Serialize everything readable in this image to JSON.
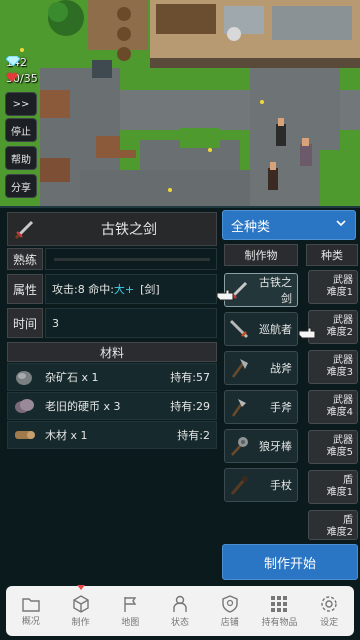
{
  "hud": {
    "diamonds": "142",
    "hp": "30/35"
  },
  "side_buttons": [
    ">>",
    "停止",
    "帮助",
    "分享"
  ],
  "item": {
    "name": "古铁之剑",
    "rows": [
      {
        "label": "熟练",
        "value": ""
      },
      {
        "label": "属性",
        "attack_text": "攻击:8 命中:",
        "hit_value": "大+",
        "tag": "[剑]"
      },
      {
        "label": "时间",
        "value": "3"
      }
    ]
  },
  "materials": {
    "title": "材料",
    "items": [
      {
        "name": "杂矿石 x 1",
        "have": "持有:57",
        "icon": "ore-icon"
      },
      {
        "name": "老旧的硬币 x 3",
        "have": "持有:29",
        "icon": "coin-icon"
      },
      {
        "name": "木材 x 1",
        "have": "持有:2",
        "icon": "wood-icon"
      }
    ]
  },
  "filter": {
    "selected": "全种类"
  },
  "craft_list": {
    "header": "制作物",
    "items": [
      {
        "name": "古铁之剑",
        "icon": "sword-icon"
      },
      {
        "name": "巡航者",
        "icon": "spear-icon"
      },
      {
        "name": "战斧",
        "icon": "axe-icon"
      },
      {
        "name": "手斧",
        "icon": "hatchet-icon"
      },
      {
        "name": "狼牙棒",
        "icon": "mace-icon"
      },
      {
        "name": "手杖",
        "icon": "staff-icon"
      }
    ]
  },
  "type_list": {
    "header": "种类",
    "items": [
      {
        "line1": "武器",
        "line2": "难度1"
      },
      {
        "line1": "武器",
        "line2": "难度2"
      },
      {
        "line1": "武器",
        "line2": "难度3"
      },
      {
        "line1": "武器",
        "line2": "难度4"
      },
      {
        "line1": "武器",
        "line2": "难度5"
      },
      {
        "line1": "盾",
        "line2": "难度1"
      },
      {
        "line1": "盾",
        "line2": "难度2"
      }
    ]
  },
  "start_button": "制作开始",
  "nav": {
    "items": [
      {
        "label": "概况",
        "icon": "folder-icon"
      },
      {
        "label": "制作",
        "icon": "box-icon"
      },
      {
        "label": "地图",
        "icon": "flag-icon"
      },
      {
        "label": "状态",
        "icon": "person-icon"
      },
      {
        "label": "店铺",
        "icon": "shield-icon"
      },
      {
        "label": "持有物品",
        "icon": "grid-icon"
      },
      {
        "label": "设定",
        "icon": "gear-icon"
      }
    ]
  },
  "colors": {
    "accent_blue": "#2a76c4",
    "panel_bg": "#0a1a1d",
    "hit_cyan": "#3fd0e8",
    "nav_alert": "#e84a4a"
  }
}
